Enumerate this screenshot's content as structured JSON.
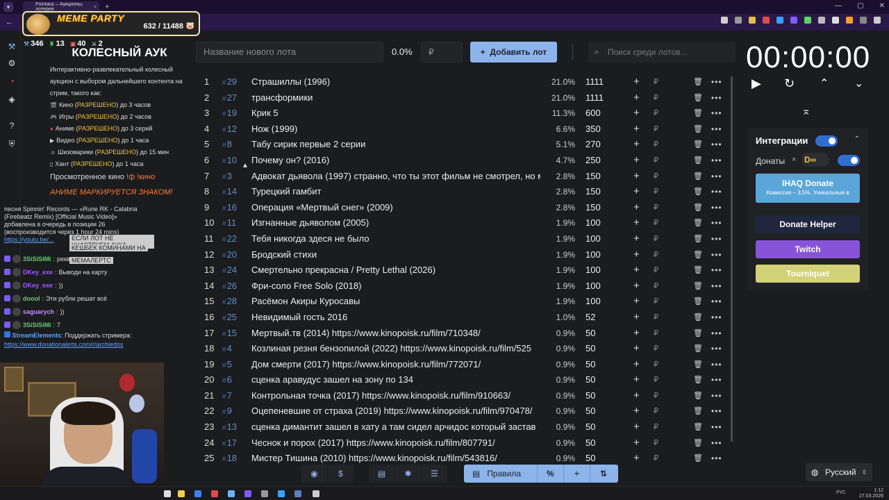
{
  "browser": {
    "tab_title": "Pointauc – Аукционы, лотерея",
    "tab_close": "×",
    "new_tab": "+",
    "window_controls": [
      "—",
      "▢",
      "✕"
    ]
  },
  "meme_party": {
    "title": "MEME PARTY",
    "count": "632 / 11488"
  },
  "stream_stats": [
    {
      "icon": "hammer-icon",
      "value": "346",
      "color": "#7fd6ff"
    },
    {
      "icon": "rook-icon",
      "value": "13",
      "color": "#5cd36b"
    },
    {
      "icon": "badge-icon",
      "value": "40",
      "color": "#ff6b6b"
    },
    {
      "icon": "swords-icon",
      "value": "2",
      "color": "#dddddd"
    }
  ],
  "description": {
    "title": "КОЛЕСНЫЙ АУК",
    "intro": "Интерактивно-развлекательный колесный аукцион с выбором дальнейшего контента на стрим, такого как:",
    "rules": [
      {
        "icon": "film-icon",
        "label": "Кино",
        "status": "РАЗРЕШЕНО",
        "limit": "до 3 часов"
      },
      {
        "icon": "gamepad-icon",
        "label": "Игры",
        "status": "РАЗРЕШЕНО",
        "limit": "до 2 часов"
      },
      {
        "icon": "anime-icon",
        "label": "Аниме",
        "status": "РАЗРЕШЕНО",
        "limit": "до 3 серий"
      },
      {
        "icon": "video-icon",
        "label": "Видео",
        "status": "РАЗРЕШЕНО",
        "limit": "до 1 часа"
      },
      {
        "icon": "smile-icon",
        "label": "Шизоварики",
        "status": "РАЗРЕШЕНО",
        "limit": "до 15 мин"
      },
      {
        "icon": "hunt-icon",
        "label": "Хант",
        "status": "РАЗРЕШЕНО",
        "limit": "до 1 часа"
      }
    ],
    "watched_label": "Просмотренное кино",
    "watched_cmd": "!ф !кино",
    "anime_warning": "АНИМЕ МАРКИРУЕТСЯ ЗНАКОМ!"
  },
  "chat": {
    "system_text": "песня Spinnin' Records — «Rune RK - Calabria (Firebeatz Remix) [Official Music Video]» добавлена в очередь в позиции 26 (воспроизводится через 1 hour 24 mins)",
    "system_link": "https://youtu.be/...",
    "overlay_a": "ЕСЛИ ЛОТ НЕ УЧАСТВУЕМ АУКА",
    "overlay_b": "КЕШБЕК КОМИНАМИ НА",
    "overlay_c": "МЕМАЛЕРТС",
    "messages": [
      {
        "user": "3SiSiSiMi",
        "color": "#5cd36b",
        "text": "реквием по мечте"
      },
      {
        "user": "DKey_exe",
        "color": "#a05cff",
        "text": "Выводи на карту"
      },
      {
        "user": "DKey_exe",
        "color": "#a05cff",
        "text": "))"
      },
      {
        "user": "doool",
        "color": "#5cd36b",
        "text": "Эти рубли решат всё"
      },
      {
        "user": "saguarych",
        "color": "#c48cff",
        "text": "))"
      },
      {
        "user": "3SiSiSiMi",
        "color": "#5cd36b",
        "text": "7"
      }
    ],
    "streamelements_user": "StreamElements",
    "streamelements_text": "Поддержать стримера:",
    "streamelements_link": "https://www.donationalerts.com/r/archiedos"
  },
  "controls": {
    "lot_name_placeholder": "Название нового лота",
    "percent": "0.0%",
    "currency_placeholder": "₽",
    "add_button": "Добавить лот",
    "search_placeholder": "Поиск среди лотов..."
  },
  "lots": [
    {
      "n": "1",
      "id": "29",
      "name": "Страшиллы (1996)",
      "pct": "21.0%",
      "amount": "1111"
    },
    {
      "n": "2",
      "id": "27",
      "name": "трансформики",
      "pct": "21.0%",
      "amount": "1111"
    },
    {
      "n": "3",
      "id": "19",
      "name": "Крик 5",
      "pct": "11.3%",
      "amount": "600"
    },
    {
      "n": "4",
      "id": "12",
      "name": "Нож (1999)",
      "pct": "6.6%",
      "amount": "350"
    },
    {
      "n": "5",
      "id": "8",
      "name": "Табу сирик первые 2 серии",
      "pct": "5.1%",
      "amount": "270"
    },
    {
      "n": "6",
      "id": "10",
      "name": "Почему он? (2016)",
      "pct": "4.7%",
      "amount": "250"
    },
    {
      "n": "7",
      "id": "3",
      "name": "Адвокат дьявола (1997) странно, что ты этот фильм не смотрел, но м",
      "pct": "2.8%",
      "amount": "150"
    },
    {
      "n": "8",
      "id": "14",
      "name": "Турецкий гамбит",
      "pct": "2.8%",
      "amount": "150"
    },
    {
      "n": "9",
      "id": "16",
      "name": "Операция «Мертвый снег» (2009)",
      "pct": "2.8%",
      "amount": "150"
    },
    {
      "n": "10",
      "id": "11",
      "name": "Изгнанные дьяволом (2005)",
      "pct": "1.9%",
      "amount": "100"
    },
    {
      "n": "11",
      "id": "22",
      "name": "Тебя никогда здеся не было",
      "pct": "1.9%",
      "amount": "100"
    },
    {
      "n": "12",
      "id": "20",
      "name": "Бродский стихи",
      "pct": "1.9%",
      "amount": "100"
    },
    {
      "n": "13",
      "id": "24",
      "name": "Смертельно прекрасна / Pretty Lethal (2026)",
      "pct": "1.9%",
      "amount": "100"
    },
    {
      "n": "14",
      "id": "26",
      "name": "Фри-соло Free Solo (2018)",
      "pct": "1.9%",
      "amount": "100"
    },
    {
      "n": "15",
      "id": "28",
      "name": "Расёмон Акиры Куросавы",
      "pct": "1.9%",
      "amount": "100"
    },
    {
      "n": "16",
      "id": "25",
      "name": "Невидимый гость 2016",
      "pct": "1.0%",
      "amount": "52"
    },
    {
      "n": "17",
      "id": "15",
      "name": "Мертвый.тв (2014) https://www.kinopoisk.ru/film/710348/",
      "pct": "0.9%",
      "amount": "50"
    },
    {
      "n": "18",
      "id": "4",
      "name": "Козлиная резня бензопилой (2022) https://www.kinopoisk.ru/film/525",
      "pct": "0.9%",
      "amount": "50"
    },
    {
      "n": "19",
      "id": "5",
      "name": "Дом смерти (2017) https://www.kinopoisk.ru/film/772071/",
      "pct": "0.9%",
      "amount": "50"
    },
    {
      "n": "20",
      "id": "6",
      "name": "сценка аравудус зашел на зону по 134",
      "pct": "0.9%",
      "amount": "50"
    },
    {
      "n": "21",
      "id": "7",
      "name": "Контрольная точка (2017) https://www.kinopoisk.ru/film/910663/",
      "pct": "0.9%",
      "amount": "50"
    },
    {
      "n": "22",
      "id": "9",
      "name": "Оцепеневшие от страха (2019) https://www.kinopoisk.ru/film/970478/",
      "pct": "0.9%",
      "amount": "50"
    },
    {
      "n": "23",
      "id": "13",
      "name": "сценка димантит зашел в хату а там сидел арчидос который застав",
      "pct": "0.9%",
      "amount": "50"
    },
    {
      "n": "24",
      "id": "17",
      "name": "Чеснок и порох (2017) https://www.kinopoisk.ru/film/807791/",
      "pct": "0.9%",
      "amount": "50"
    },
    {
      "n": "25",
      "id": "18",
      "name": "Мистер Тишина (2010) https://www.kinopoisk.ru/film/543816/",
      "pct": "0.9%",
      "amount": "50"
    }
  ],
  "bottom_bar": {
    "rules_label": "Правила"
  },
  "timer": {
    "display": "00:00:00"
  },
  "integrations": {
    "title": "Интеграции",
    "donations_label": "Донаты",
    "ihaq_title": "IHAQ Donate",
    "ihaq_subtitle": "Комиссия – 3,5%. Уникальные в",
    "donate_helper": "Donate Helper",
    "twitch": "Twitch",
    "tourniquet": "Tourniquet"
  },
  "language": {
    "selected": "Русский"
  },
  "taskbar": {
    "lang": "РУС",
    "time": "1:12",
    "date": "27.03.2026"
  }
}
